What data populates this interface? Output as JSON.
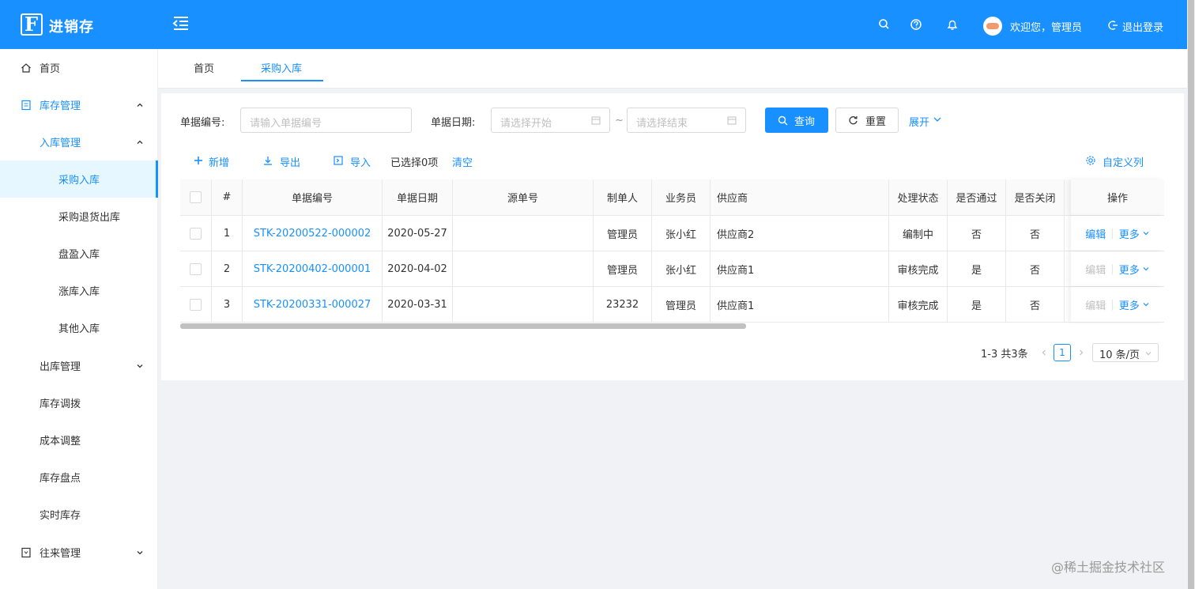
{
  "app": {
    "brand": "进销存",
    "logo_letter": "F"
  },
  "header": {
    "welcome": "欢迎您，管理员",
    "logout": "退出登录",
    "icons": [
      "search-icon",
      "help-icon",
      "bell-icon"
    ]
  },
  "sidebar": {
    "items": [
      {
        "label": "首页",
        "icon": "home-icon"
      },
      {
        "label": "库存管理",
        "icon": "inventory-icon"
      },
      {
        "label": "入库管理"
      },
      {
        "label": "采购入库"
      },
      {
        "label": "采购退货出库"
      },
      {
        "label": "盘盈入库"
      },
      {
        "label": "涨库入库"
      },
      {
        "label": "其他入库"
      },
      {
        "label": "出库管理"
      },
      {
        "label": "库存调拨"
      },
      {
        "label": "成本调整"
      },
      {
        "label": "库存盘点"
      },
      {
        "label": "实时库存"
      },
      {
        "label": "往来管理",
        "icon": "contacts-icon"
      }
    ]
  },
  "tabs": [
    "首页",
    "采购入库"
  ],
  "filters": {
    "code_label": "单据编号:",
    "code_placeholder": "请输入单据编号",
    "date_label": "单据日期:",
    "start_placeholder": "请选择开始",
    "range_sep": "~",
    "end_placeholder": "请选择结束",
    "search": "查询",
    "reset": "重置",
    "expand": "展开"
  },
  "toolbar": {
    "add": "新增",
    "export": "导出",
    "import": "导入",
    "selected": "已选择0项",
    "clear": "清空",
    "custom_columns": "自定义列"
  },
  "table": {
    "headers": [
      "#",
      "单据编号",
      "单据日期",
      "源单号",
      "制单人",
      "业务员",
      "供应商",
      "处理状态",
      "是否通过",
      "是否关闭",
      "操作"
    ],
    "rows": [
      {
        "no": "1",
        "code": "STK-20200522-000002",
        "date": "2020-05-27",
        "source": "",
        "creator": "管理员",
        "salesman": "张小红",
        "supplier": "供应商2",
        "status": "编制中",
        "passed": "否",
        "closed": "否",
        "edit": "编辑",
        "more": "更多",
        "edit_disabled": false
      },
      {
        "no": "2",
        "code": "STK-20200402-000001",
        "date": "2020-04-02",
        "source": "",
        "creator": "管理员",
        "salesman": "张小红",
        "supplier": "供应商1",
        "status": "审核完成",
        "passed": "是",
        "closed": "否",
        "edit": "编辑",
        "more": "更多",
        "edit_disabled": true
      },
      {
        "no": "3",
        "code": "STK-20200331-000027",
        "date": "2020-03-31",
        "source": "",
        "creator": "23232",
        "salesman": "管理员",
        "supplier": "供应商1",
        "status": "审核完成",
        "passed": "是",
        "closed": "否",
        "edit": "编辑",
        "more": "更多",
        "edit_disabled": true
      }
    ]
  },
  "pagination": {
    "total_text": "1-3 共3条",
    "current": "1",
    "page_size": "10 条/页"
  },
  "watermark": "@稀土掘金技术社区",
  "colors": {
    "primary": "#1890ff",
    "bg": "#f0f2f5"
  }
}
